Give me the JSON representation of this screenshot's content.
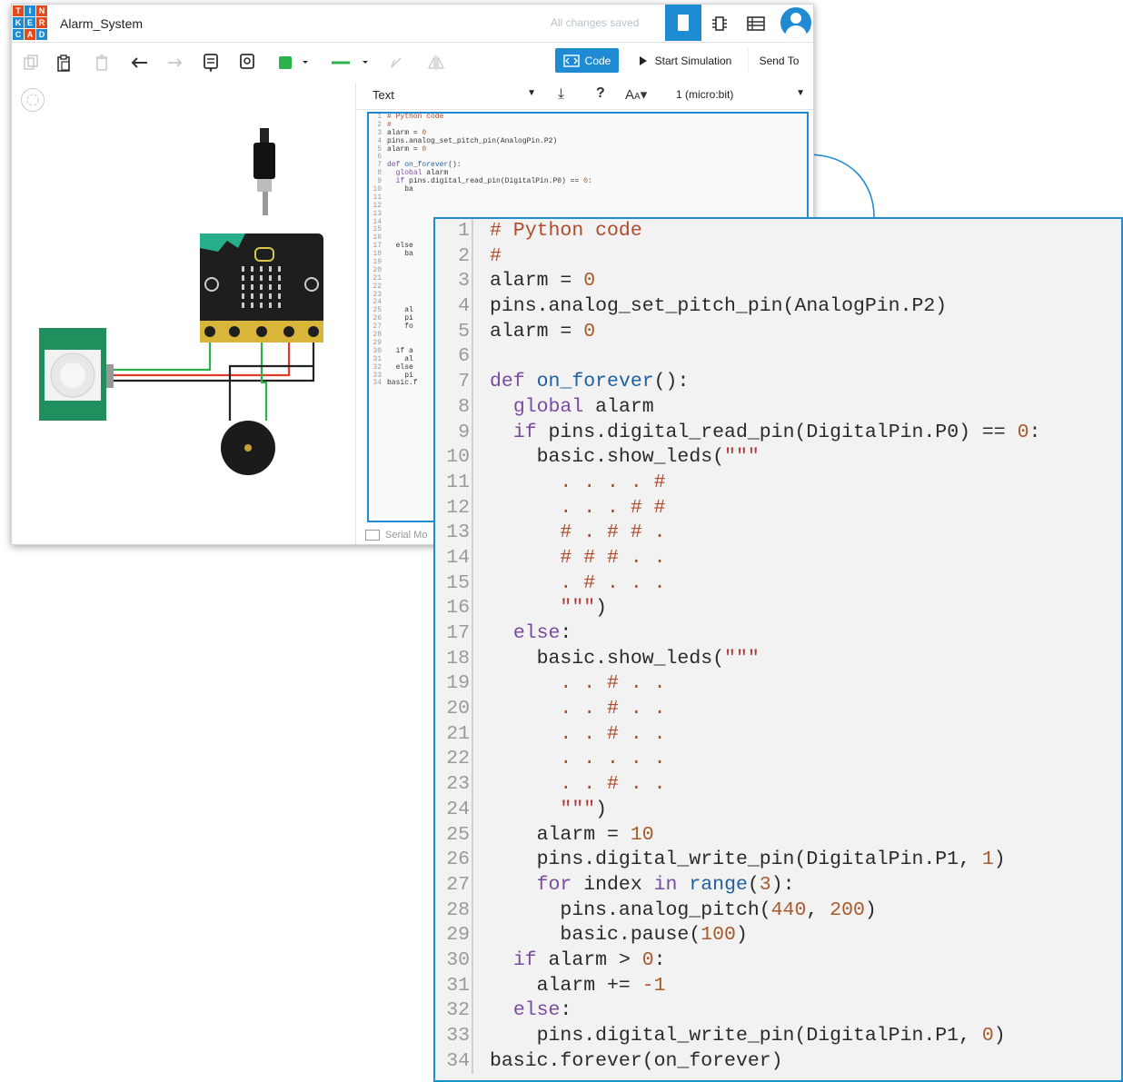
{
  "app": {
    "logo_letters": [
      "T",
      "I",
      "N",
      "K",
      "E",
      "R",
      "C",
      "A",
      "D"
    ],
    "logo_colors": [
      "#e3491b",
      "#1f8bd3",
      "#e3491b",
      "#1f8bd3",
      "#1f8bd3",
      "#e3491b",
      "#1f8bd3",
      "#e3491b",
      "#1f8bd3"
    ],
    "doc_title": "Alarm_System",
    "save_status": "All changes saved",
    "accent": "#1f8bd3"
  },
  "titlebar_icons": [
    "circuit-view-icon",
    "component-list-icon",
    "bill-of-materials-icon",
    "user-avatar"
  ],
  "toolbar": {
    "code_label": "Code",
    "simulate_label": "Start Simulation",
    "send_label": "Send To",
    "wire_color": "#2bb24c"
  },
  "code_panel": {
    "mode": "Text",
    "device": "1 (micro:bit)",
    "serial_label": "Serial Mo",
    "visible_line_stubs": {
      "10": "ba",
      "17": "else",
      "18": "ba",
      "25": "al",
      "26": "pi",
      "27": "fo",
      "30": "if a",
      "31": "al",
      "32": "else",
      "33": "pi",
      "34": "basic.f"
    }
  },
  "code_lines": [
    {
      "n": "1",
      "text": "# Python code"
    },
    {
      "n": "2",
      "text": "#"
    },
    {
      "n": "3",
      "text": "alarm = 0"
    },
    {
      "n": "4",
      "text": "pins.analog_set_pitch_pin(AnalogPin.P2)"
    },
    {
      "n": "5",
      "text": "alarm = 0"
    },
    {
      "n": "6",
      "text": ""
    },
    {
      "n": "7",
      "text": "def on_forever():"
    },
    {
      "n": "8",
      "text": "  global alarm"
    },
    {
      "n": "9",
      "text": "  if pins.digital_read_pin(DigitalPin.P0) == 0:"
    },
    {
      "n": "10",
      "text": "    basic.show_leds(\"\"\""
    },
    {
      "n": "11",
      "text": "      . . . . #"
    },
    {
      "n": "12",
      "text": "      . . . # #"
    },
    {
      "n": "13",
      "text": "      # . # # ."
    },
    {
      "n": "14",
      "text": "      # # # . ."
    },
    {
      "n": "15",
      "text": "      . # . . ."
    },
    {
      "n": "16",
      "text": "      \"\"\")"
    },
    {
      "n": "17",
      "text": "  else:"
    },
    {
      "n": "18",
      "text": "    basic.show_leds(\"\"\""
    },
    {
      "n": "19",
      "text": "      . . # . ."
    },
    {
      "n": "20",
      "text": "      . . # . ."
    },
    {
      "n": "21",
      "text": "      . . # . ."
    },
    {
      "n": "22",
      "text": "      . . . . ."
    },
    {
      "n": "23",
      "text": "      . . # . ."
    },
    {
      "n": "24",
      "text": "      \"\"\")"
    },
    {
      "n": "25",
      "text": "    alarm = 10"
    },
    {
      "n": "26",
      "text": "    pins.digital_write_pin(DigitalPin.P1, 1)"
    },
    {
      "n": "27",
      "text": "    for index in range(3):"
    },
    {
      "n": "28",
      "text": "      pins.analog_pitch(440, 200)"
    },
    {
      "n": "29",
      "text": "      basic.pause(100)"
    },
    {
      "n": "30",
      "text": "  if alarm > 0:"
    },
    {
      "n": "31",
      "text": "    alarm += -1"
    },
    {
      "n": "32",
      "text": "  else:"
    },
    {
      "n": "33",
      "text": "    pins.digital_write_pin(DigitalPin.P1, 0)"
    },
    {
      "n": "34",
      "text": "basic.forever(on_forever)"
    }
  ]
}
